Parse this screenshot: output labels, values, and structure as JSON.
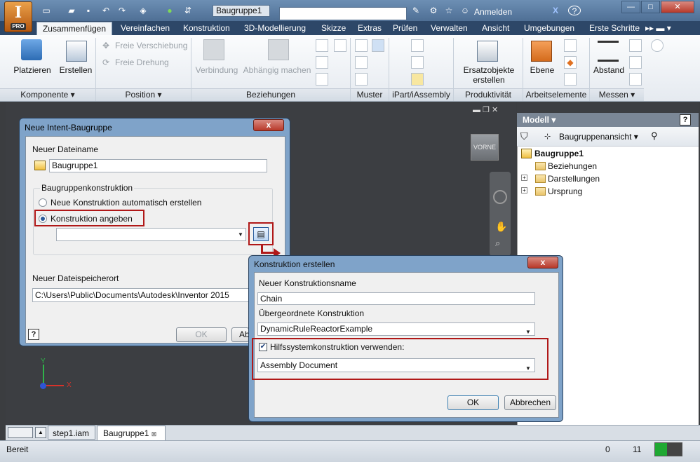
{
  "app": {
    "logo_letter": "I",
    "logo_badge": "PRO",
    "document_title": "Baugruppe1",
    "signin_label": "Anmelden",
    "help_label": "?"
  },
  "ribbon": {
    "tabs": [
      "Zusammenfügen",
      "Vereinfachen",
      "Konstruktion",
      "3D-Modellierung",
      "Skizze",
      "Extras",
      "Prüfen",
      "Verwalten",
      "Ansicht",
      "Umgebungen",
      "Erste Schritte"
    ],
    "active_tab": "Zusammenfügen",
    "buttons": {
      "platzieren": "Platzieren",
      "erstellen": "Erstellen",
      "freie_verschiebung": "Freie Verschiebung",
      "freie_drehung": "Freie Drehung",
      "verbindung": "Verbindung",
      "abhaengig": "Abhängig machen",
      "ersatz_line1": "Ersatzobjekte",
      "ersatz_line2": "erstellen",
      "ebene": "Ebene",
      "abstand": "Abstand"
    },
    "panels": [
      "Komponente",
      "Position",
      "Beziehungen",
      "Muster",
      "iPart/iAssembly",
      "Produktivität",
      "Arbeitselemente",
      "Messen"
    ]
  },
  "viewcube": {
    "label": "VORNE"
  },
  "triad": {
    "x": "X",
    "y": "Y"
  },
  "browser": {
    "title": "Modell",
    "view_label": "Baugruppenansicht",
    "tree": [
      {
        "label": "Baugruppe1",
        "bold": true
      },
      {
        "label": "Beziehungen"
      },
      {
        "label": "Darstellungen"
      },
      {
        "label": "Ursprung"
      }
    ]
  },
  "doc_tabs": [
    "step1.iam",
    "Baugruppe1"
  ],
  "status": {
    "text": "Bereit",
    "count1": "0",
    "count2": "11"
  },
  "dialog1": {
    "title": "Neue Intent-Baugruppe",
    "close": "x",
    "filename_label": "Neuer Dateiname",
    "filename_value": "Baugruppe1",
    "group_label": "Baugruppenkonstruktion",
    "radio_auto": "Neue Konstruktion automatisch erstellen",
    "radio_specify": "Konstruktion angeben",
    "location_label": "Neuer Dateispeicherort",
    "location_value": "C:\\Users\\Public\\Documents\\Autodesk\\Inventor 2015",
    "ok": "OK",
    "cancel_partial": "Ab",
    "help": "?"
  },
  "dialog2": {
    "title": "Konstruktion erstellen",
    "close": "x",
    "name_label": "Neuer Konstruktionsname",
    "name_value": "Chain",
    "parent_label": "Übergeordnete Konstruktion",
    "parent_value": "DynamicRuleReactorExample",
    "checkbox_label": "Hilfssystemkonstruktion verwenden:",
    "checkbox_checked": true,
    "system_value": "Assembly Document",
    "ok": "OK",
    "cancel": "Abbrechen"
  },
  "colors": {
    "titlebar": "#4f6f95",
    "accent_red": "#b01818",
    "dialog_frame": "#7fa3c9",
    "viewport": "#3c3e42"
  }
}
